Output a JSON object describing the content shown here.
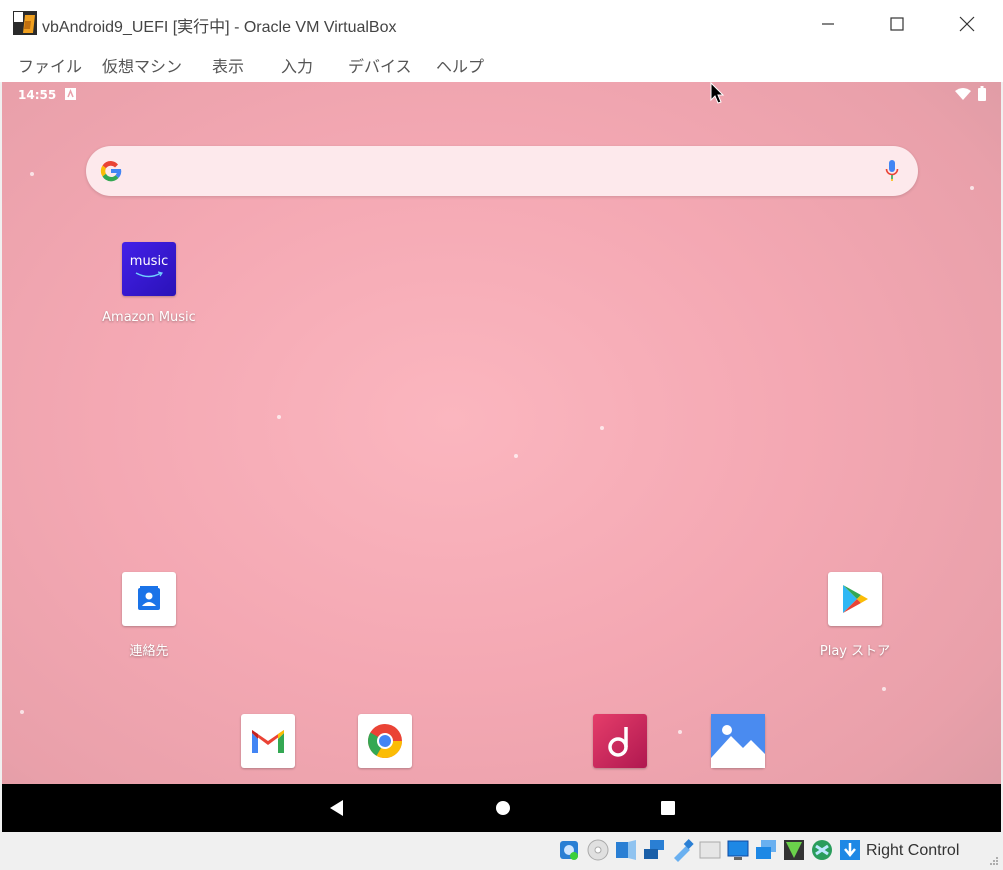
{
  "window": {
    "title": "vbAndroid9_UEFI [実行中] - Oracle VM VirtualBox"
  },
  "menu": {
    "items": [
      "ファイル",
      "仮想マシン",
      "表示",
      "入力",
      "デバイス",
      "ヘルプ"
    ]
  },
  "status_bar": {
    "time": "14:55"
  },
  "home": {
    "apps": {
      "amazon_music": {
        "label": "Amazon Music",
        "tile_text": "music"
      },
      "contacts": {
        "label": "連絡先"
      },
      "play_store": {
        "label": "Play ストア"
      }
    },
    "dock": [
      "gmail-icon",
      "chrome-icon",
      "music-player-icon",
      "gallery-icon"
    ]
  },
  "vbox_status": {
    "host_key": "Right Control"
  },
  "colors": {
    "wallpaper": "#f4a8b3",
    "amazon_music_tile": "#3a1fd6",
    "navbar": "#000000"
  }
}
